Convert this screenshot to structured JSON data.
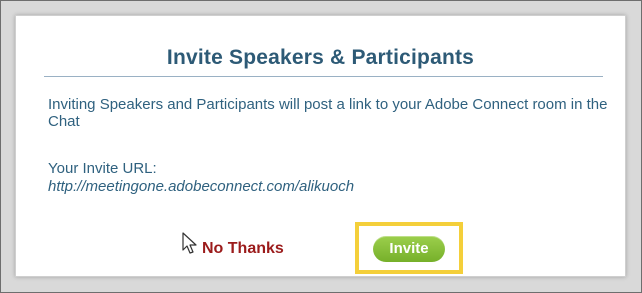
{
  "dialog": {
    "title": "Invite Speakers & Participants",
    "message": "Inviting Speakers and Participants will post a link to your Adobe Connect room in the Chat",
    "url_label": "Your Invite URL:",
    "url_value": "http://meetingone.adobeconnect.com/alikuoch",
    "no_thanks_label": "No Thanks",
    "invite_label": "Invite"
  },
  "colors": {
    "title": "#2d5a76",
    "body_text": "#2f617f",
    "no_thanks": "#9b1b1b",
    "invite_button": "#84bd34",
    "highlight": "#f4cf3a"
  },
  "icons": {
    "cursor": "mouse-pointer-icon"
  }
}
